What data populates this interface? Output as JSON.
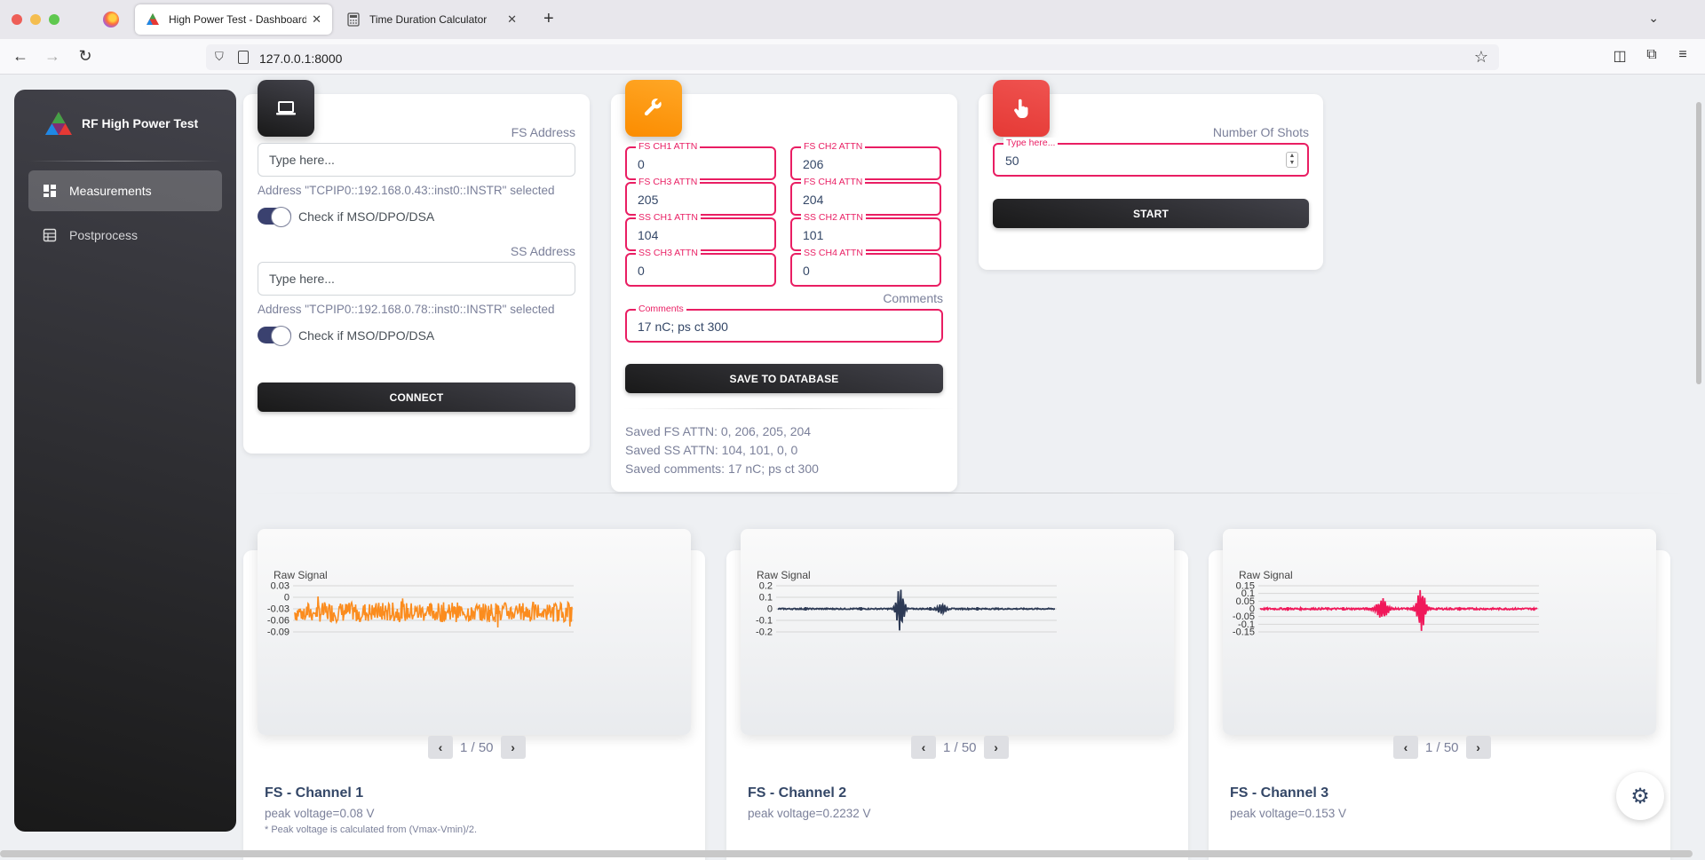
{
  "browser": {
    "tabs": [
      {
        "title": "High Power Test - Dashboard",
        "active": true
      },
      {
        "title": "Time Duration Calculator",
        "active": false
      }
    ],
    "url": "127.0.0.1:8000"
  },
  "sidebar": {
    "brand": "RF High Power Test",
    "items": [
      {
        "label": "Measurements",
        "active": true,
        "icon": "dashboard-icon"
      },
      {
        "label": "Postprocess",
        "active": false,
        "icon": "table-icon"
      }
    ]
  },
  "connect_card": {
    "fs_label": "FS Address",
    "fs_placeholder": "Type here...",
    "fs_selected": "Address \"TCPIP0::192.168.0.43::inst0::INSTR\" selected",
    "fs_check": "Check if MSO/DPO/DSA",
    "ss_label": "SS Address",
    "ss_placeholder": "Type here...",
    "ss_selected": "Address \"TCPIP0::192.168.0.78::inst0::INSTR\" selected",
    "ss_check": "Check if MSO/DPO/DSA",
    "button": "CONNECT"
  },
  "attn_card": {
    "fields": [
      {
        "label": "FS CH1 ATTN",
        "value": "0"
      },
      {
        "label": "FS CH2 ATTN",
        "value": "206"
      },
      {
        "label": "FS CH3 ATTN",
        "value": "205"
      },
      {
        "label": "FS CH4 ATTN",
        "value": "204"
      },
      {
        "label": "SS CH1 ATTN",
        "value": "104"
      },
      {
        "label": "SS CH2 ATTN",
        "value": "101"
      },
      {
        "label": "SS CH3 ATTN",
        "value": "0"
      },
      {
        "label": "SS CH4 ATTN",
        "value": "0"
      }
    ],
    "comments_right_label": "Comments",
    "comments_label": "Comments",
    "comments_value": "17 nC; ps ct 300",
    "button": "SAVE TO DATABASE",
    "saved_fs": "Saved FS ATTN: 0, 206, 205, 204",
    "saved_ss": "Saved SS ATTN: 104, 101, 0, 0",
    "saved_comments": "Saved comments: 17 nC; ps ct 300"
  },
  "shots_card": {
    "label": "Number Of Shots",
    "field_label": "Type here...",
    "value": "50",
    "button": "START"
  },
  "channels": [
    {
      "title": "FS - Channel 1",
      "peak": "peak voltage=0.08 V",
      "note": "* Peak voltage is calculated from (Vmax-Vmin)/2.",
      "chart_title": "Raw Signal",
      "pager": "1 / 50",
      "color": "#fb8c1e"
    },
    {
      "title": "FS - Channel 2",
      "peak": "peak voltage=0.2232 V",
      "note": "",
      "chart_title": "Raw Signal",
      "pager": "1 / 50",
      "color": "#2d3a55"
    },
    {
      "title": "FS - Channel 3",
      "peak": "peak voltage=0.153 V",
      "note": "",
      "chart_title": "Raw Signal",
      "pager": "1 / 50",
      "color": "#f0185a"
    }
  ],
  "chart_data": [
    {
      "type": "line",
      "title": "Raw Signal",
      "yticks": [
        "0.03",
        "0",
        "-0.03",
        "-0.06",
        "-0.09"
      ],
      "ylim": [
        -0.1,
        0.05
      ],
      "pattern": "noise",
      "series": [
        {
          "color": "#fb8c1e"
        }
      ]
    },
    {
      "type": "line",
      "title": "Raw Signal",
      "yticks": [
        "0.2",
        "0.1",
        "0",
        "-0.1",
        "-0.2"
      ],
      "ylim": [
        -0.25,
        0.25
      ],
      "pattern": "burst1",
      "series": [
        {
          "color": "#2d3a55"
        }
      ]
    },
    {
      "type": "line",
      "title": "Raw Signal",
      "yticks": [
        "0.15",
        "0.1",
        "0.05",
        "0",
        "-0.05",
        "-0.1",
        "-0.15"
      ],
      "ylim": [
        -0.17,
        0.17
      ],
      "pattern": "burst2",
      "series": [
        {
          "color": "#f0185a"
        }
      ]
    }
  ]
}
